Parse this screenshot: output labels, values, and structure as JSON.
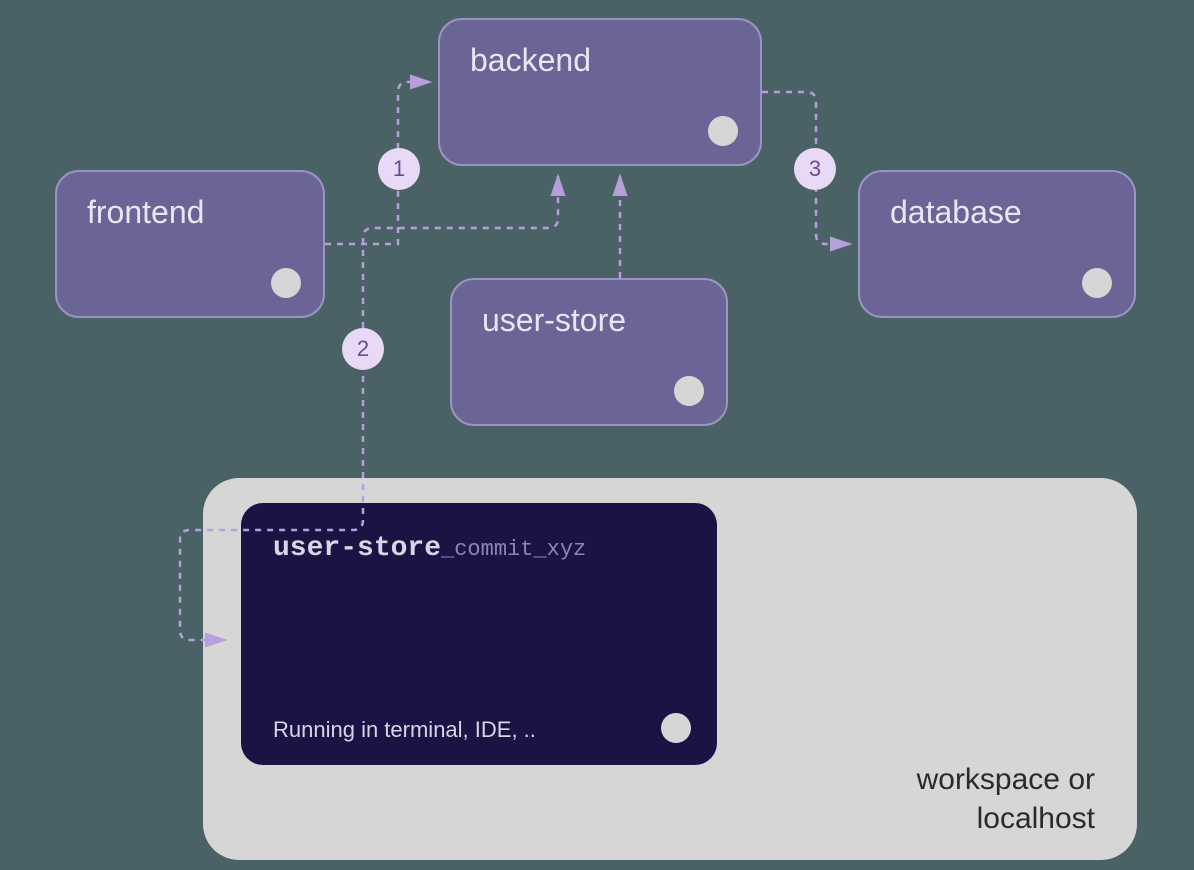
{
  "nodes": {
    "frontend": {
      "label": "frontend"
    },
    "backend": {
      "label": "backend"
    },
    "userstore": {
      "label": "user-store"
    },
    "database": {
      "label": "database"
    }
  },
  "workspace": {
    "code": {
      "name": "user-store",
      "suffix": "_commit_xyz",
      "status": "Running in terminal, IDE, .."
    },
    "label_line1": "workspace or",
    "label_line2": "localhost"
  },
  "badges": {
    "b1": "1",
    "b2": "2",
    "b3": "3"
  }
}
